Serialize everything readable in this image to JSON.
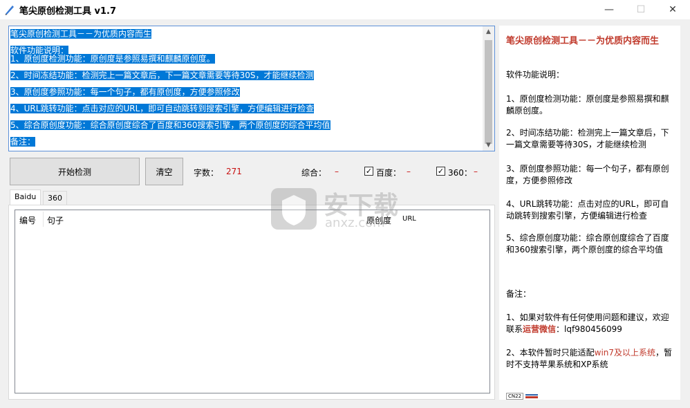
{
  "window": {
    "title": "笔尖原创检测工具 v1.7",
    "minimize": "—",
    "maximize": "☐",
    "close": "✕"
  },
  "editor": {
    "lines": [
      "笔尖原创检测工具－－为优质内容而生",
      "软件功能说明：",
      "1、原创度检测功能：原创度是参照易撰和麒麟原创度。",
      "2、时间冻结功能：检测完上一篇文章后，下一篇文章需要等待30S，才能继续检测",
      "3、原创度参照功能：每一个句子，都有原创度，方便参照修改",
      "4、URL跳转功能：点击对应的URL，即可自动跳转到搜索引擎，方便编辑进行检查",
      "5、综合原创度功能：综合原创度综合了百度和360搜索引擎，两个原创度的综合平均值",
      "备注："
    ]
  },
  "toolbar": {
    "start_label": "开始检测",
    "clear_label": "清空",
    "word_count_label": "字数：",
    "word_count_value": "271",
    "overall_label": "综合：",
    "overall_value": "–",
    "baidu_label": "百度：",
    "baidu_value": "–",
    "baidu_checked": true,
    "s360_label": "360：",
    "s360_value": "–",
    "s360_checked": true,
    "check_mark": "✓"
  },
  "tabs": [
    {
      "label": "Baidu",
      "active": true
    },
    {
      "label": "360",
      "active": false
    }
  ],
  "results_table": {
    "columns": [
      "编号",
      "句子",
      "原创度",
      "URL"
    ],
    "rows": []
  },
  "watermark": {
    "text": "安下载",
    "domain": "anxz.com"
  },
  "info_panel": {
    "headline": "笔尖原创检测工具－－为优质内容而生",
    "intro": "软件功能说明：",
    "items": [
      "1、原创度检测功能：原创度是参照易撰和麒麟原创度。",
      "2、时间冻结功能：检测完上一篇文章后，下一篇文章需要等待30S，才能继续检测",
      "3、原创度参照功能：每一个句子，都有原创度，方便参照修改",
      "4、URL跳转功能：点击对应的URL，即可自动跳转到搜索引擎，方便编辑进行检查",
      "5、综合原创度功能：综合原创度综合了百度和360搜索引擎，两个原创度的综合平均值"
    ],
    "note_label": "备注：",
    "note1_prefix": "1、如果对软件有任何使用问题和建议，欢迎联系",
    "note1_highlight": "运营微信",
    "note1_suffix": "：lqf980456099",
    "note2_prefix": "2、本软件暂时只能适配",
    "note2_highlight": "win7及以上系统",
    "note2_suffix": "，暂时不支持苹果系统和XP系统",
    "badge": "CN22"
  },
  "colors": {
    "selection": "#0078d7",
    "accent_red": "#c81010",
    "headline_red": "#c0392b"
  }
}
